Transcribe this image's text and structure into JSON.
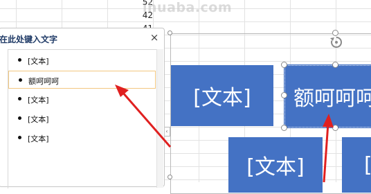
{
  "sheet": {
    "row_numbers": [
      "52",
      "42",
      "41"
    ]
  },
  "watermark": "ihuaba.com",
  "text_pane": {
    "title": "在此处键入文字",
    "close_label": "×",
    "items": [
      {
        "label": "[文本]"
      },
      {
        "label": "额呵呵呵"
      },
      {
        "label": "[文本]"
      },
      {
        "label": "[文本]"
      },
      {
        "label": "[文本]"
      }
    ]
  },
  "smartart": {
    "shapes": [
      {
        "label": "[文本]"
      },
      {
        "label": "额呵呵呵"
      },
      {
        "label": "[文本]"
      },
      {
        "label": "["
      }
    ],
    "fill_color": "#4472c4",
    "collapse_tab": "‹"
  },
  "annotation": {
    "arrow_color": "#e02020"
  }
}
